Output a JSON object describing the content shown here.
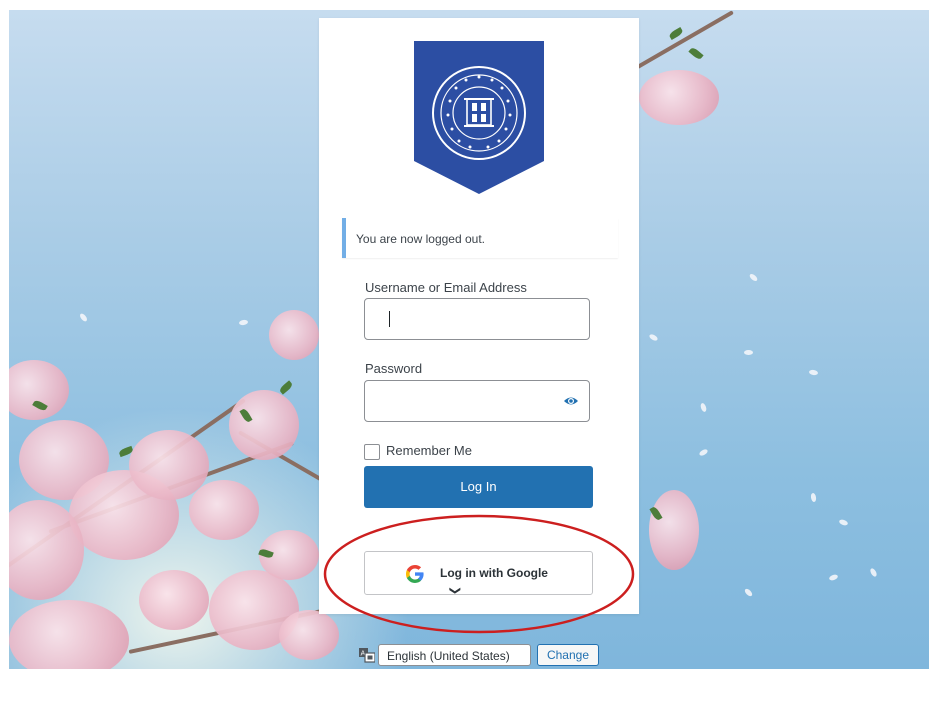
{
  "notice": {
    "message": "You are now logged out."
  },
  "form": {
    "username_label": "Username or Email Address",
    "username_value": "",
    "password_label": "Password",
    "password_value": "",
    "remember_label": "Remember Me",
    "remember_checked": false,
    "login_button": "Log In",
    "google_button": "Log in with Google"
  },
  "logo": {
    "top_text": "ილიას სახელმწიფო უნივერსიტეტი",
    "middle_text": "LIBRARY",
    "bottom_text": "ILIA STATE UNIVERSITY",
    "color": "#2c4ea3"
  },
  "language": {
    "selected": "English (United States)",
    "change_button": "Change"
  },
  "colors": {
    "primary": "#2271b1",
    "annotation_circle": "#cc1f1f",
    "notice_border": "#72aee6"
  },
  "icons": {
    "password_toggle": "eye-icon",
    "google": "google-g-icon",
    "language": "translation-icon",
    "select_arrow": "chevron-down-icon"
  }
}
